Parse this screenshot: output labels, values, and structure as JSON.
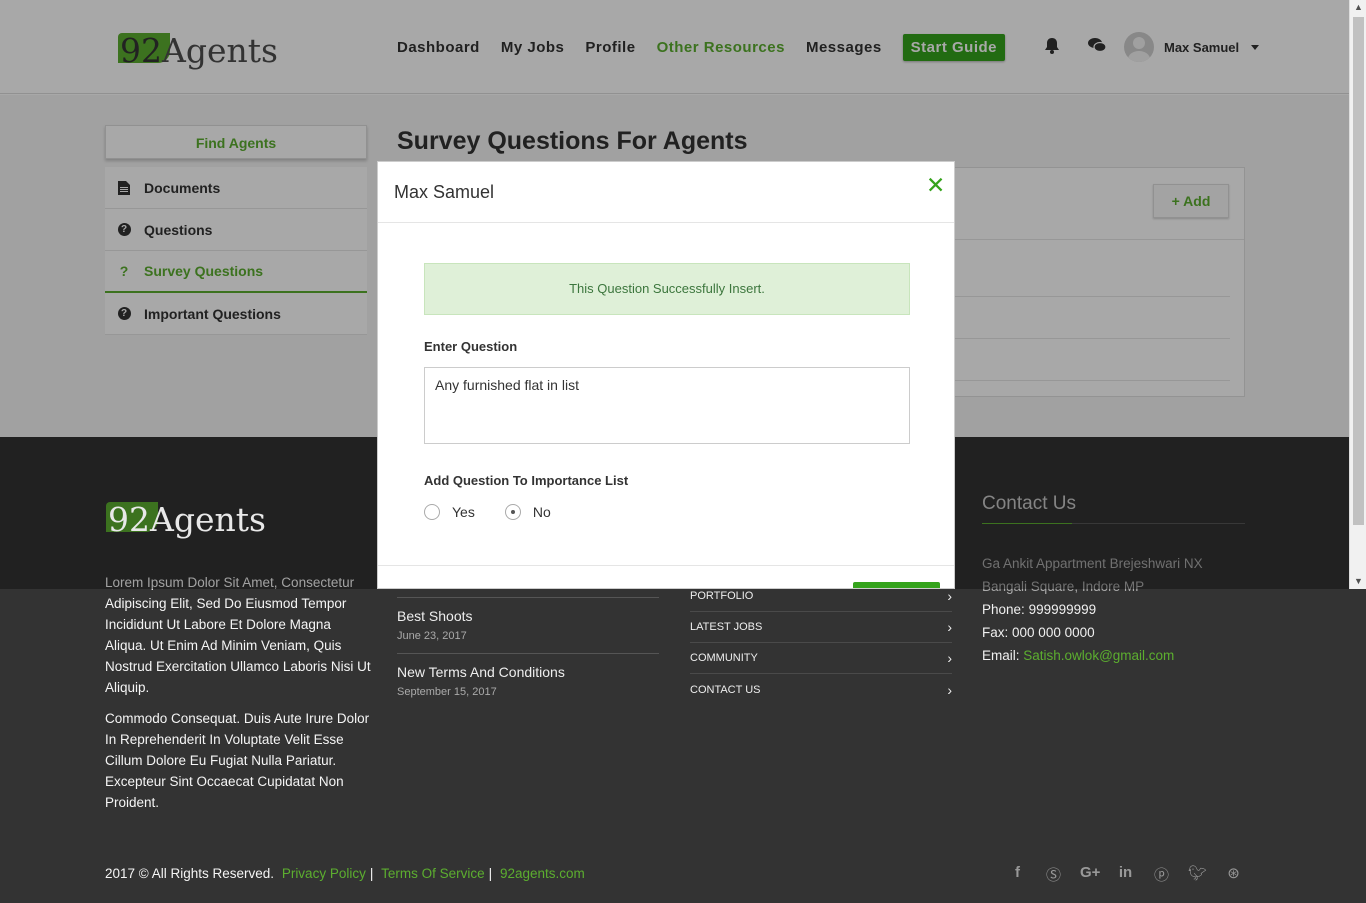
{
  "header": {
    "logo_num": "92",
    "logo_rest": "Agents",
    "nav": [
      {
        "label": "Dashboard",
        "active": false
      },
      {
        "label": "My Jobs",
        "active": false
      },
      {
        "label": "Profile",
        "active": false
      },
      {
        "label": "Other Resources",
        "active": true
      },
      {
        "label": "Messages",
        "active": false
      }
    ],
    "start_guide": "Start Guide",
    "user_name": "Max Samuel",
    "icons": [
      "bell-icon",
      "chat-icon"
    ]
  },
  "sidebar": {
    "find_agents": "Find Agents",
    "items": [
      {
        "label": "Documents",
        "icon": "document-icon"
      },
      {
        "label": "Questions",
        "icon": "question-circle-icon"
      },
      {
        "label": "Survey Questions",
        "icon": "question-icon",
        "active": true
      },
      {
        "label": "Important Questions",
        "icon": "question-circle-icon"
      }
    ]
  },
  "main": {
    "title": "Survey Questions For Agents",
    "add_button": "+ Add"
  },
  "modal": {
    "title": "Max Samuel",
    "alert": "This Question Successfully Insert.",
    "question_label": "Enter Question",
    "question_value": "Any furnished flat in list",
    "importance_label": "Add Question To Importance List",
    "options": [
      {
        "label": "Yes",
        "checked": false
      },
      {
        "label": "No",
        "checked": true
      }
    ]
  },
  "footer": {
    "logo_num": "92",
    "logo_rest": "Agents",
    "about_1": "Lorem Ipsum Dolor Sit Amet, Consectetur Adipiscing Elit, Sed Do Eiusmod Tempor Incididunt Ut Labore Et Dolore Magna Aliqua. Ut Enim Ad Minim Veniam, Quis Nostrud Exercitation Ullamco Laboris Nisi Ut Aliquip.",
    "about_2": "Commodo Consequat. Duis Aute Irure Dolor In Reprehenderit In Voluptate Velit Esse Cillum Dolore Eu Fugiat Nulla Pariatur. Excepteur Sint Occaecat Cupidatat Non Proident.",
    "posts": [
      {
        "title": "Best Shoots",
        "date": "June 23, 2017"
      },
      {
        "title": "New Terms And Conditions",
        "date": "September 15, 2017"
      }
    ],
    "links": [
      "PORTFOLIO",
      "LATEST JOBS",
      "COMMUNITY",
      "CONTACT US"
    ],
    "contact": {
      "title": "Contact Us",
      "address_1": "Ga Ankit Appartment Brejeshwari NX",
      "address_2": "Bangali Square, Indore MP",
      "phone_label": "Phone:",
      "phone": "999999999",
      "fax_label": "Fax:",
      "fax": "000 000 0000",
      "email_label": "Email:",
      "email": "Satish.owlok@gmail.com"
    },
    "copyright": "2017 © All Rights Reserved.",
    "privacy": "Privacy Policy",
    "terms": "Terms Of Service",
    "site": "92agents.com",
    "sep": "|",
    "social": [
      "facebook-icon",
      "skype-icon",
      "google-plus-icon",
      "linkedin-icon",
      "pinterest-icon",
      "twitter-icon",
      "dribbble-icon"
    ]
  },
  "colors": {
    "accent": "#5cae2f",
    "button_green": "#35a31c",
    "footer_bg": "#333333"
  }
}
